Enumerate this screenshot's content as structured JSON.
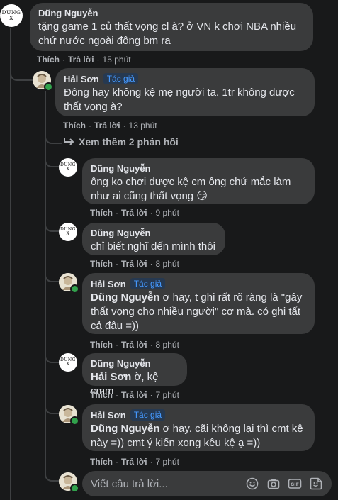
{
  "comments": [
    {
      "author": "Dũng Nguyễn",
      "author_badge": "",
      "text": "tặng game 1 củ thất vọng cl à? ở VN k chơi NBA nhiều chứ nước ngoài đông bm ra",
      "like": "Thích",
      "reply": "Trả lời",
      "time": "15 phút"
    },
    {
      "author": "Hải Sơn",
      "author_badge": "Tác giả",
      "text": "Đông hay không kệ mẹ người ta. 1tr không được thất vọng à?",
      "like": "Thích",
      "reply": "Trả lời",
      "time": "13 phút"
    }
  ],
  "see_more_replies": "Xem thêm 2 phản hồi",
  "replies": [
    {
      "author": "Dũng Nguyễn",
      "author_badge": "",
      "mention": "",
      "text": "ông ko chơi dược kệ cm ông chứ mắc làm như ai cũng thất vọng",
      "emoji": "😏",
      "like": "Thích",
      "reply": "Trả lời",
      "time": "9 phút"
    },
    {
      "author": "Dũng Nguyễn",
      "author_badge": "",
      "mention": "",
      "text": "chỉ biết nghĩ đến mình thôi",
      "emoji": "",
      "like": "Thích",
      "reply": "Trả lời",
      "time": "8 phút"
    },
    {
      "author": "Hải Sơn",
      "author_badge": "Tác giả",
      "mention": "Dũng Nguyễn",
      "text": " ơ hay, t ghi rất rõ ràng là \"gây thất vọng cho nhiều người\" cơ mà. có ghi tất cả đâu =))",
      "emoji": "",
      "like": "Thích",
      "reply": "Trả lời",
      "time": "8 phút"
    },
    {
      "author": "Dũng Nguyễn",
      "author_badge": "",
      "mention": "Hải Sơn",
      "text": " ờ, kệ cmm",
      "emoji": "",
      "like": "Thích",
      "reply": "Trả lời",
      "time": "7 phút"
    },
    {
      "author": "Hải Sơn",
      "author_badge": "Tác giả",
      "mention": "Dũng Nguyễn",
      "text": " ơ hay. cãi không lại thì cmt kệ này =)) cmt ý kiến xong kêu kệ ạ =))",
      "emoji": "",
      "like": "Thích",
      "reply": "Trả lời",
      "time": "7 phút"
    }
  ],
  "reply_box": {
    "placeholder": "Viết câu trả lời..."
  },
  "avatars": {
    "dung_monogram_top": "DUNG",
    "dung_monogram_bottom": "X"
  },
  "toolbar_icons": [
    "emoji-icon",
    "camera-icon",
    "gif-icon",
    "sticker-icon"
  ],
  "colors": {
    "background": "#18191a",
    "bubble": "#3a3b3c",
    "text": "#e4e6eb",
    "muted": "#b0b3b8",
    "badge_text": "#4599ff",
    "badge_bg": "#263951",
    "online": "#31a24c"
  }
}
